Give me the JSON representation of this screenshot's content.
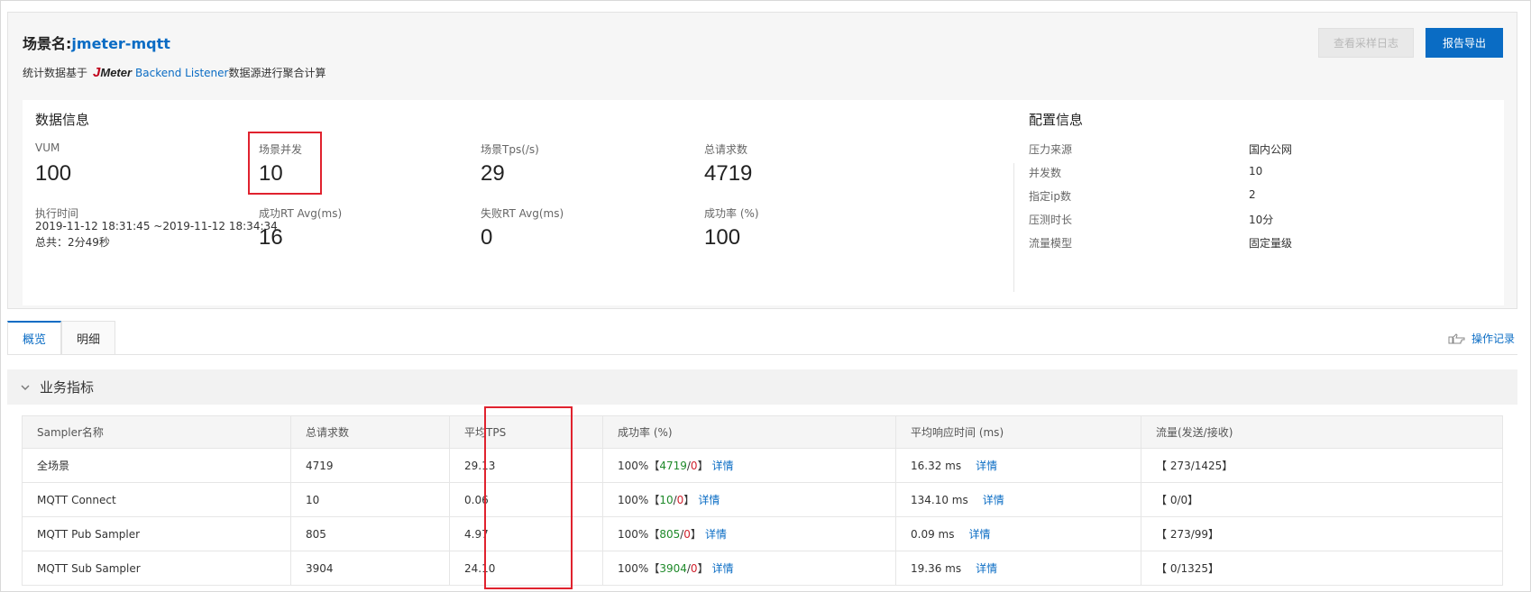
{
  "header": {
    "scene_prefix": "场景名:",
    "scene_name": "jmeter-mqtt",
    "note_prefix": "统计数据基于",
    "logo_j": "J",
    "logo_rest": "Meter",
    "note_link": "Backend Listener",
    "note_suffix": "数据源进行聚合计算",
    "btn_log": "查看采样日志",
    "btn_export": "报告导出"
  },
  "data_info": {
    "title": "数据信息",
    "vum_label": "VUM",
    "vum_value": "100",
    "concurrency_label": "场景并发",
    "concurrency_value": "10",
    "tps_label": "场景Tps(/s)",
    "tps_value": "29",
    "total_label": "总请求数",
    "total_value": "4719",
    "time_label": "执行时间",
    "time_range": "2019-11-12 18:31:45 ~2019-11-12 18:34:34",
    "time_total": "总共：2分49秒",
    "success_rt_label": "成功RT Avg(ms)",
    "success_rt_value": "16",
    "fail_rt_label": "失败RT Avg(ms)",
    "fail_rt_value": "0",
    "success_rate_label": "成功率 (%)",
    "success_rate_value": "100"
  },
  "config_info": {
    "title": "配置信息",
    "items": [
      {
        "label": "压力来源",
        "value": "国内公网"
      },
      {
        "label": "并发数",
        "value": "10"
      },
      {
        "label": "指定ip数",
        "value": "2"
      },
      {
        "label": "压测时长",
        "value": "10分"
      },
      {
        "label": "流量模型",
        "value": "固定量级"
      }
    ]
  },
  "tabs": [
    "概览",
    "明细"
  ],
  "ops_record": "操作记录",
  "business": {
    "title": "业务指标",
    "columns": [
      "Sampler名称",
      "总请求数",
      "平均TPS",
      "成功率 (%)",
      "平均响应时间 (ms)",
      "流量(发送/接收)"
    ],
    "detail_label": "详情",
    "rows": [
      {
        "name": "全场景",
        "total": "4719",
        "tps": "29.13",
        "rate": "100%",
        "ok": "4719",
        "fail": "0",
        "rt": "16.32 ms",
        "traffic": "【 273/1425】"
      },
      {
        "name": "MQTT Connect",
        "total": "10",
        "tps": "0.06",
        "rate": "100%",
        "ok": "10",
        "fail": "0",
        "rt": "134.10 ms",
        "traffic": "【 0/0】"
      },
      {
        "name": "MQTT Pub Sampler",
        "total": "805",
        "tps": "4.97",
        "rate": "100%",
        "ok": "805",
        "fail": "0",
        "rt": "0.09 ms",
        "traffic": "【 273/99】"
      },
      {
        "name": "MQTT Sub Sampler",
        "total": "3904",
        "tps": "24.10",
        "rate": "100%",
        "ok": "3904",
        "fail": "0",
        "rt": "19.36 ms",
        "traffic": "【 0/1325】"
      }
    ]
  }
}
